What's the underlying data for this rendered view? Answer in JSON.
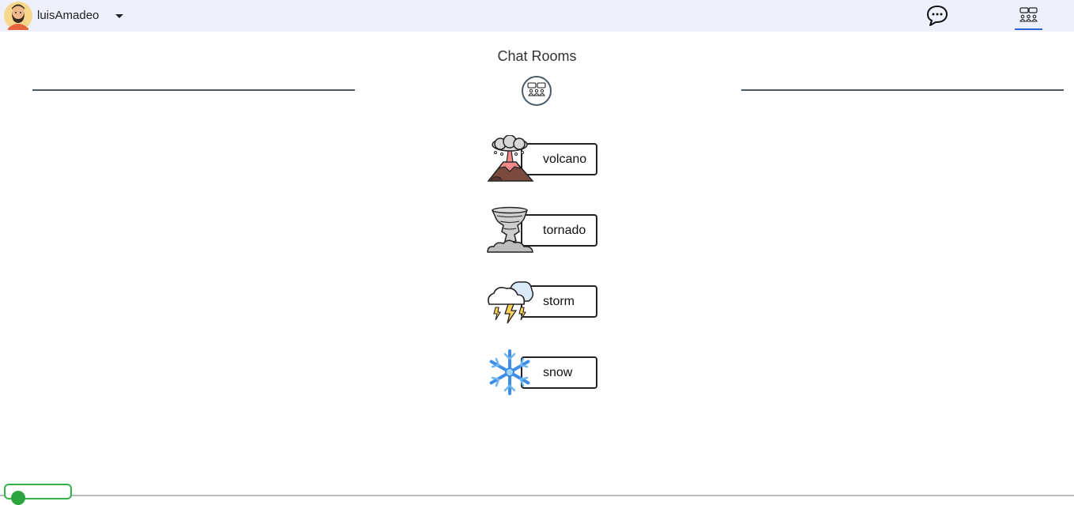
{
  "topbar": {
    "username": "luisAmadeo",
    "icons": {
      "avatar": "bearded-man-avatar",
      "user_menu": "caret-down-icon",
      "chat_nav": "chat-bubble-icon",
      "rooms_nav": "chat-rooms-icon"
    },
    "active_nav": "rooms"
  },
  "main": {
    "title": "Chat Rooms",
    "badge_icon": "chat-rooms-icon",
    "rooms": [
      {
        "label": "volcano",
        "icon": "volcano-icon"
      },
      {
        "label": "tornado",
        "icon": "tornado-icon"
      },
      {
        "label": "storm",
        "icon": "storm-icon"
      },
      {
        "label": "snow",
        "icon": "snowflake-icon"
      }
    ]
  },
  "colors": {
    "topbar_bg": "#eef0fc",
    "active_underline": "#2b62d9",
    "divider": "#4a5a68",
    "status_green": "#2da53f"
  }
}
